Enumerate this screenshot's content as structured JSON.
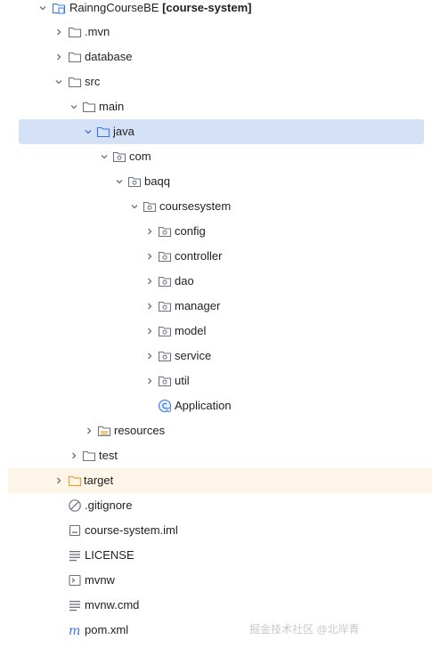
{
  "project": {
    "name": "RainngCourseBE",
    "module": "[course-system]"
  },
  "tree": {
    "mvn": ".mvn",
    "database": "database",
    "src": "src",
    "main": "main",
    "java": "java",
    "com": "com",
    "baqq": "baqq",
    "coursesystem": "coursesystem",
    "config": "config",
    "controller": "controller",
    "dao": "dao",
    "manager": "manager",
    "model": "model",
    "service": "service",
    "util": "util",
    "application": "Application",
    "resources": "resources",
    "test": "test",
    "target": "target",
    "gitignore": ".gitignore",
    "iml": "course-system.iml",
    "license": "LICENSE",
    "mvnw": "mvnw",
    "mvnw_cmd": "mvnw.cmd",
    "pom": "pom.xml"
  },
  "watermark": "掘金技术社区 @北岸青"
}
